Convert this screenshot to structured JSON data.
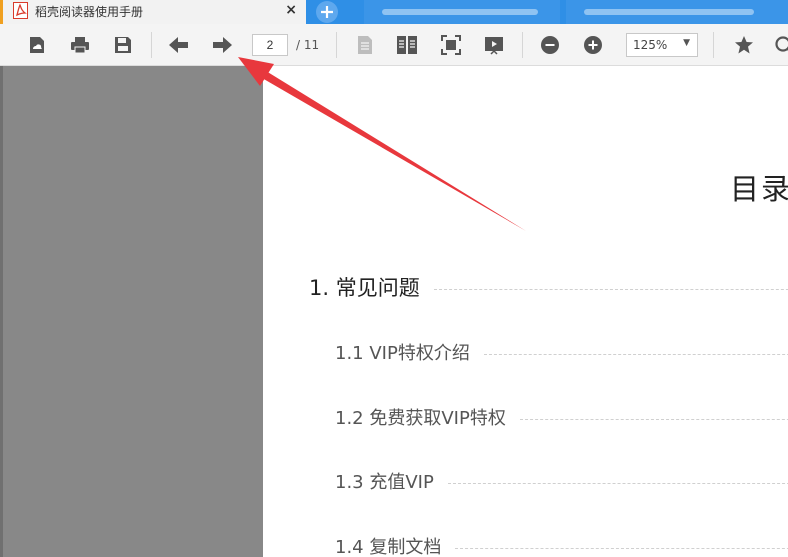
{
  "tabs": {
    "active_title": "稻壳阅读器使用手册",
    "close_glyph": "×",
    "add_glyph": "+"
  },
  "toolbar": {
    "current_page": "2",
    "page_total": "/ 11",
    "zoom_value": "125%",
    "zoom_arrow": "▼"
  },
  "document": {
    "title": "目录",
    "toc": [
      {
        "label": "1. 常见问题"
      },
      {
        "label": "1.1 VIP特权介绍"
      },
      {
        "label": "1.2  免费获取VIP特权"
      },
      {
        "label": "1.3  充值VIP"
      },
      {
        "label": "1.4  复制文档"
      }
    ]
  },
  "icons": [
    "pdf-icon",
    "open-file-icon",
    "print-icon",
    "save-icon",
    "back-arrow-icon",
    "forward-arrow-icon",
    "single-page-icon",
    "two-page-icon",
    "fit-page-icon",
    "slideshow-icon",
    "zoom-out-icon",
    "zoom-in-icon",
    "star-icon",
    "search-icon"
  ],
  "colors": {
    "tabbar": "#2f8fe6",
    "active_tab_accent": "#f0a020",
    "annotation_arrow": "#e8383d"
  }
}
